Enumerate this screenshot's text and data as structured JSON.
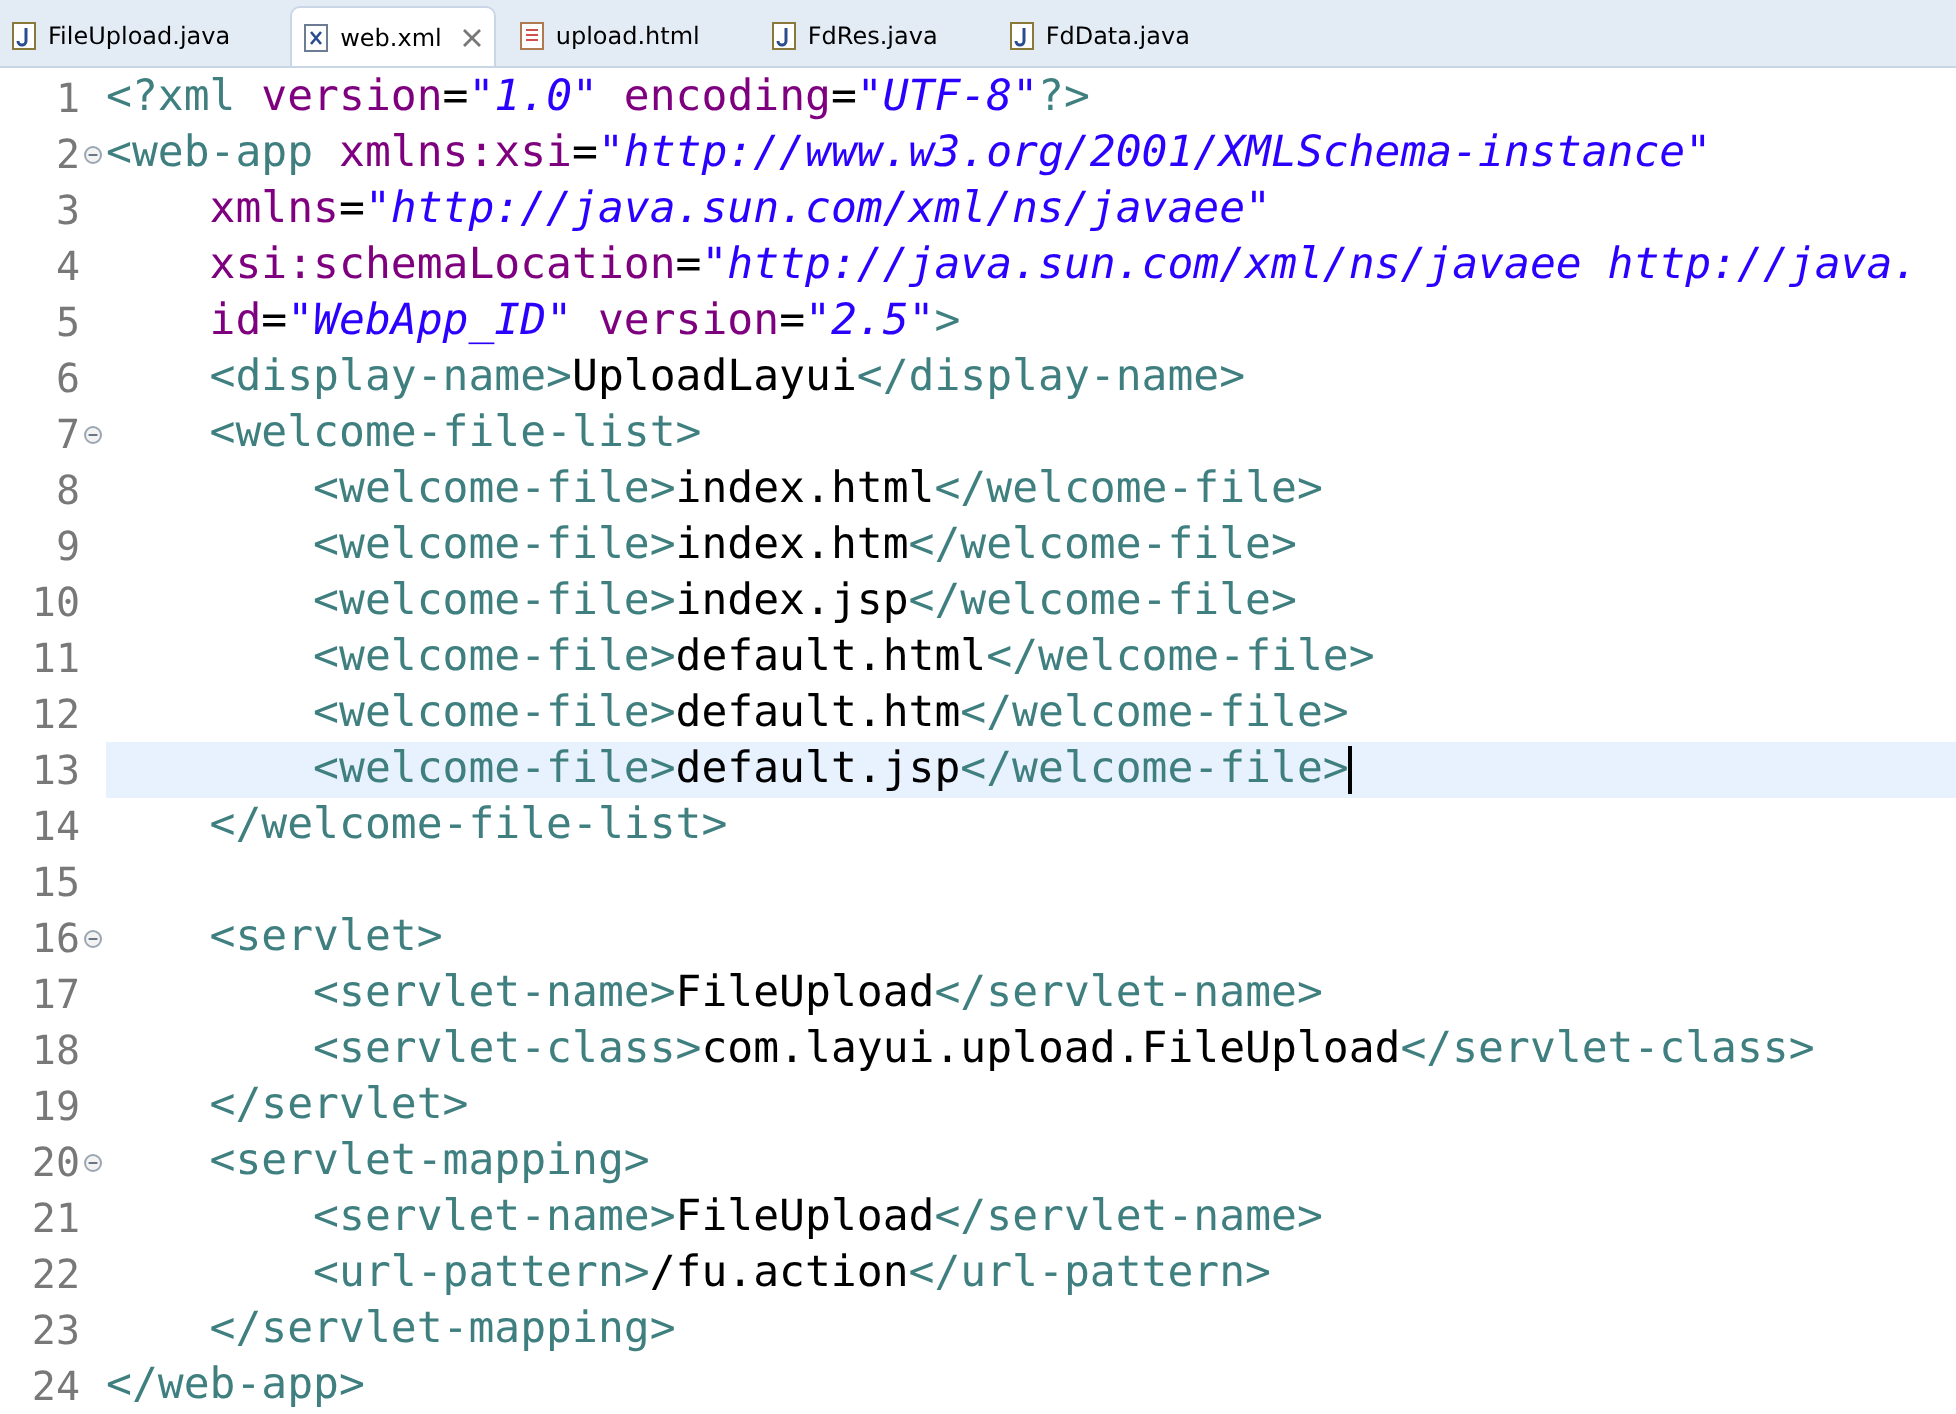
{
  "tabs": [
    {
      "label": "FileUpload.java",
      "kind": "java",
      "selected": false
    },
    {
      "label": "web.xml",
      "kind": "xml",
      "selected": true
    },
    {
      "label": "upload.html",
      "kind": "html",
      "selected": false
    },
    {
      "label": "FdRes.java",
      "kind": "java",
      "selected": false
    },
    {
      "label": "FdData.java",
      "kind": "java",
      "selected": false
    }
  ],
  "editor": {
    "lines": [
      {
        "number": "1",
        "collapsible": false,
        "current": false,
        "tokens": [
          {
            "kind": "tag",
            "text": "<?xml "
          },
          {
            "kind": "attr",
            "text": "version"
          },
          {
            "kind": "text",
            "text": "="
          },
          {
            "kind": "string",
            "text": "\"1.0\""
          },
          {
            "kind": "attr",
            "text": " encoding"
          },
          {
            "kind": "text",
            "text": "="
          },
          {
            "kind": "string",
            "text": "\"UTF-8\""
          },
          {
            "kind": "tag",
            "text": "?>"
          }
        ]
      },
      {
        "number": "2",
        "collapsible": true,
        "current": false,
        "tokens": [
          {
            "kind": "tag",
            "text": "<web-app "
          },
          {
            "kind": "attr",
            "text": "xmlns:xsi"
          },
          {
            "kind": "text",
            "text": "="
          },
          {
            "kind": "string",
            "text": "\"http://www.w3.org/2001/XMLSchema-instance\""
          }
        ]
      },
      {
        "number": "3",
        "collapsible": false,
        "current": false,
        "tokens": [
          {
            "kind": "attr",
            "text": "    xmlns"
          },
          {
            "kind": "text",
            "text": "="
          },
          {
            "kind": "string",
            "text": "\"http://java.sun.com/xml/ns/javaee\""
          }
        ]
      },
      {
        "number": "4",
        "collapsible": false,
        "current": false,
        "tokens": [
          {
            "kind": "attr",
            "text": "    xsi:schemaLocation"
          },
          {
            "kind": "text",
            "text": "="
          },
          {
            "kind": "string",
            "text": "\"http://java.sun.com/xml/ns/javaee http://java."
          }
        ]
      },
      {
        "number": "5",
        "collapsible": false,
        "current": false,
        "tokens": [
          {
            "kind": "attr",
            "text": "    id"
          },
          {
            "kind": "text",
            "text": "="
          },
          {
            "kind": "string",
            "text": "\"WebApp_ID\""
          },
          {
            "kind": "attr",
            "text": " version"
          },
          {
            "kind": "text",
            "text": "="
          },
          {
            "kind": "string",
            "text": "\"2.5\""
          },
          {
            "kind": "tag",
            "text": ">"
          }
        ]
      },
      {
        "number": "6",
        "collapsible": false,
        "current": false,
        "tokens": [
          {
            "kind": "tag",
            "text": "    <display-name>"
          },
          {
            "kind": "text",
            "text": "UploadLayui"
          },
          {
            "kind": "tag",
            "text": "</display-name>"
          }
        ]
      },
      {
        "number": "7",
        "collapsible": true,
        "current": false,
        "tokens": [
          {
            "kind": "tag",
            "text": "    <welcome-file-list>"
          }
        ]
      },
      {
        "number": "8",
        "collapsible": false,
        "current": false,
        "tokens": [
          {
            "kind": "tag",
            "text": "        <welcome-file>"
          },
          {
            "kind": "text",
            "text": "index.html"
          },
          {
            "kind": "tag",
            "text": "</welcome-file>"
          }
        ]
      },
      {
        "number": "9",
        "collapsible": false,
        "current": false,
        "tokens": [
          {
            "kind": "tag",
            "text": "        <welcome-file>"
          },
          {
            "kind": "text",
            "text": "index.htm"
          },
          {
            "kind": "tag",
            "text": "</welcome-file>"
          }
        ]
      },
      {
        "number": "10",
        "collapsible": false,
        "current": false,
        "tokens": [
          {
            "kind": "tag",
            "text": "        <welcome-file>"
          },
          {
            "kind": "text",
            "text": "index.jsp"
          },
          {
            "kind": "tag",
            "text": "</welcome-file>"
          }
        ]
      },
      {
        "number": "11",
        "collapsible": false,
        "current": false,
        "tokens": [
          {
            "kind": "tag",
            "text": "        <welcome-file>"
          },
          {
            "kind": "text",
            "text": "default.html"
          },
          {
            "kind": "tag",
            "text": "</welcome-file>"
          }
        ]
      },
      {
        "number": "12",
        "collapsible": false,
        "current": false,
        "tokens": [
          {
            "kind": "tag",
            "text": "        <welcome-file>"
          },
          {
            "kind": "text",
            "text": "default.htm"
          },
          {
            "kind": "tag",
            "text": "</welcome-file>"
          }
        ]
      },
      {
        "number": "13",
        "collapsible": false,
        "current": true,
        "tokens": [
          {
            "kind": "tag",
            "text": "        <welcome-file>"
          },
          {
            "kind": "text",
            "text": "default.jsp"
          },
          {
            "kind": "tag",
            "text": "</welcome-file>"
          }
        ]
      },
      {
        "number": "14",
        "collapsible": false,
        "current": false,
        "tokens": [
          {
            "kind": "tag",
            "text": "    </welcome-file-list>"
          }
        ]
      },
      {
        "number": "15",
        "collapsible": false,
        "current": false
      },
      {
        "number": "16",
        "collapsible": true,
        "current": false,
        "tokens": [
          {
            "kind": "tag",
            "text": "    <servlet>"
          }
        ]
      },
      {
        "number": "17",
        "collapsible": false,
        "current": false,
        "tokens": [
          {
            "kind": "tag",
            "text": "        <servlet-name>"
          },
          {
            "kind": "text",
            "text": "FileUpload"
          },
          {
            "kind": "tag",
            "text": "</servlet-name>"
          }
        ]
      },
      {
        "number": "18",
        "collapsible": false,
        "current": false,
        "tokens": [
          {
            "kind": "tag",
            "text": "        <servlet-class>"
          },
          {
            "kind": "text",
            "text": "com.layui.upload.FileUpload"
          },
          {
            "kind": "tag",
            "text": "</servlet-class>"
          }
        ]
      },
      {
        "number": "19",
        "collapsible": false,
        "current": false,
        "tokens": [
          {
            "kind": "tag",
            "text": "    </servlet>"
          }
        ]
      },
      {
        "number": "20",
        "collapsible": true,
        "current": false,
        "tokens": [
          {
            "kind": "tag",
            "text": "    <servlet-mapping>"
          }
        ]
      },
      {
        "number": "21",
        "collapsible": false,
        "current": false,
        "tokens": [
          {
            "kind": "tag",
            "text": "        <servlet-name>"
          },
          {
            "kind": "text",
            "text": "FileUpload"
          },
          {
            "kind": "tag",
            "text": "</servlet-name>"
          }
        ]
      },
      {
        "number": "22",
        "collapsible": false,
        "current": false,
        "tokens": [
          {
            "kind": "tag",
            "text": "        <url-pattern>"
          },
          {
            "kind": "text",
            "text": "/fu.action"
          },
          {
            "kind": "tag",
            "text": "</url-pattern>"
          }
        ]
      },
      {
        "number": "23",
        "collapsible": false,
        "current": false,
        "tokens": [
          {
            "kind": "tag",
            "text": "    </servlet-mapping>"
          }
        ]
      },
      {
        "number": "24",
        "collapsible": false,
        "current": false,
        "tokens": [
          {
            "kind": "tag",
            "text": "</web-app>"
          }
        ]
      }
    ]
  }
}
